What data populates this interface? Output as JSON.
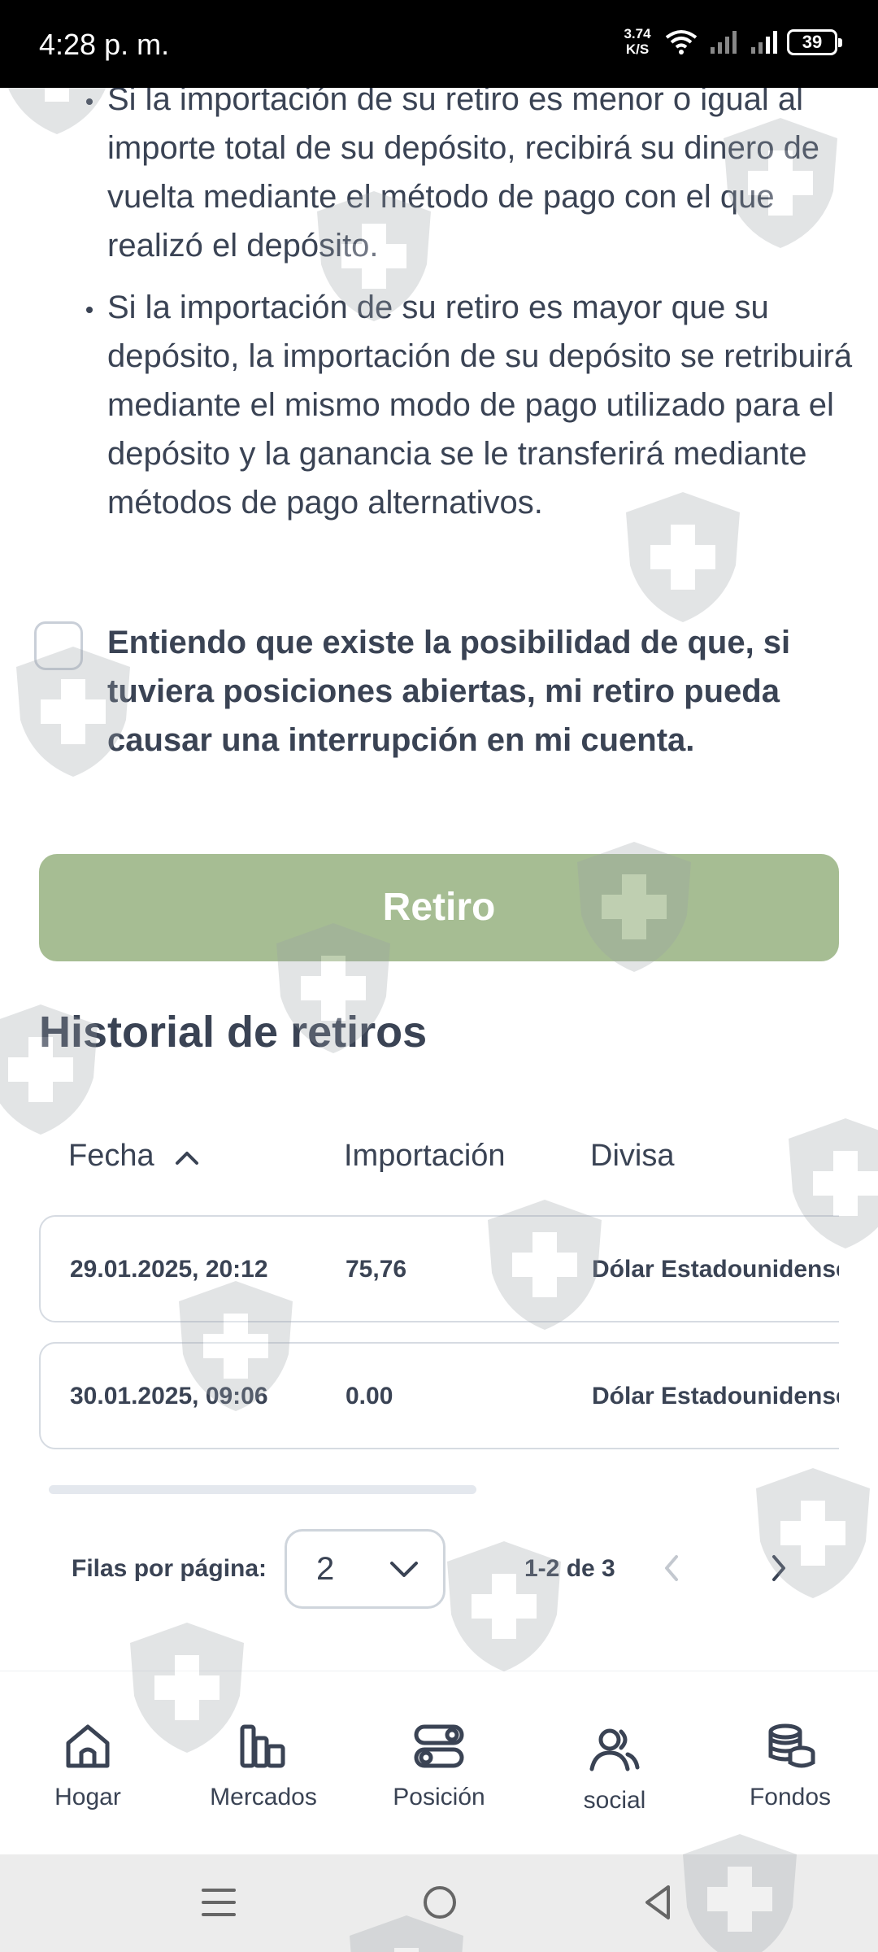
{
  "status_bar": {
    "time": "4:28 p. m.",
    "net_speed_value": "3.74",
    "net_speed_unit": "K/S",
    "battery": "39",
    "icons": [
      "wifi-icon",
      "signal-icon",
      "signal-icon",
      "battery-icon"
    ]
  },
  "content": {
    "bullets": [
      "Si la importación de su retiro es menor o igual al importe total de su depósito, recibirá su dinero de vuelta mediante el método de pago con el que realizó el depósito.",
      "Si la importación de su retiro es mayor que su depósito, la importación de su depósito se retribuirá mediante el mismo modo de pago utilizado para el depósito y la ganancia se le transferirá mediante métodos de pago alternativos."
    ],
    "checkbox_label": "Entiendo que existe la posibilidad de que, si tuviera posiciones abiertas, mi retiro pueda causar una interrupción en mi cuenta.",
    "checkbox_checked": false,
    "withdraw_button": "Retiro",
    "withdraw_button_color": "#a6bd93"
  },
  "history": {
    "title": "Historial de retiros",
    "columns": [
      "Fecha",
      "Importación",
      "Divisa"
    ],
    "sort_icon": "chevron-up-icon",
    "rows": [
      [
        "29.01.2025, 20:12",
        "75,76",
        "Dólar Estadounidense"
      ],
      [
        "30.01.2025, 09:06",
        "0.00",
        "Dólar Estadounidense"
      ]
    ],
    "pagination": {
      "rows_per_page_label": "Filas por página:",
      "rows_per_page_value": "2",
      "range": "1-2 de 3"
    }
  },
  "bottom_nav": [
    {
      "label": "Hogar",
      "icon": "home-icon"
    },
    {
      "label": "Mercados",
      "icon": "markets-icon"
    },
    {
      "label": "Posición",
      "icon": "position-icon"
    },
    {
      "label": "social",
      "icon": "social-icon"
    },
    {
      "label": "Fondos",
      "icon": "funds-icon"
    }
  ],
  "system_nav": [
    "menu-icon",
    "home-circle-icon",
    "back-icon"
  ],
  "colors": {
    "text": "#3a4354",
    "accent": "#a6bd93",
    "border": "#d6dbe2"
  }
}
